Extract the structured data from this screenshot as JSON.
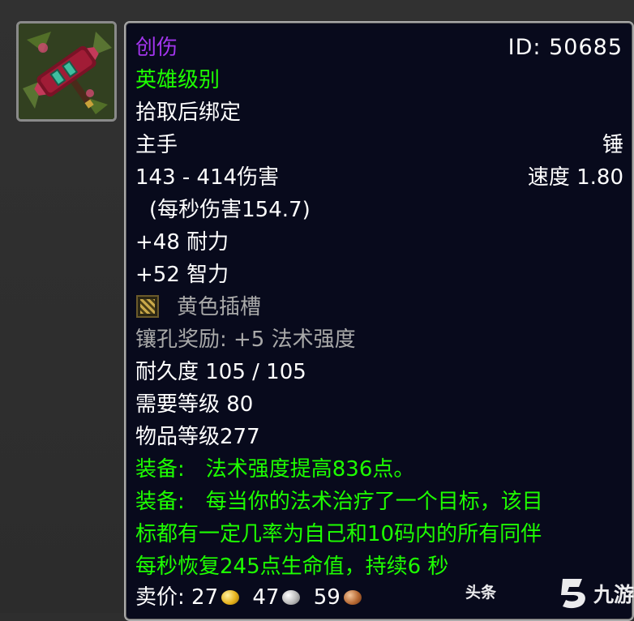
{
  "item": {
    "icon_name": "mace-weapon-icon",
    "name": "创伤",
    "id_label": "ID: 50685",
    "quality": "英雄级别",
    "bind": "拾取后绑定",
    "slot": "主手",
    "weapon_type": "锤",
    "damage": "143 - 414伤害",
    "speed": "速度 1.80",
    "dps": "(每秒伤害154.7)",
    "stat1": "+48 耐力",
    "stat2": "+52 智力",
    "socket_icon": "yellow-socket-icon",
    "socket": "黄色插槽",
    "socket_bonus": "镶孔奖励: +5 法术强度",
    "durability": "耐久度 105 / 105",
    "required_level": "需要等级 80",
    "item_level": "物品等级277",
    "equip1_label": "装备:",
    "equip1_text": "法术强度提高836点。",
    "equip2_label": "装备:",
    "equip2_text": "每当你的法术治疗了一个目标，该目",
    "equip2_line2": "标都有一定几率为自己和10码内的所有同伴",
    "equip2_line3": "每秒恢复245点生命值，持续6 秒",
    "sell_label": "卖价:",
    "gold": "27",
    "silver": "47",
    "copper": "59"
  },
  "colors": {
    "epic": "#a335ee",
    "uncommon": "#1eff00",
    "tooltip_bg": "#080a1c",
    "border": "#a9a9a9"
  },
  "watermark": {
    "text1": "头条",
    "text2": "九游"
  }
}
